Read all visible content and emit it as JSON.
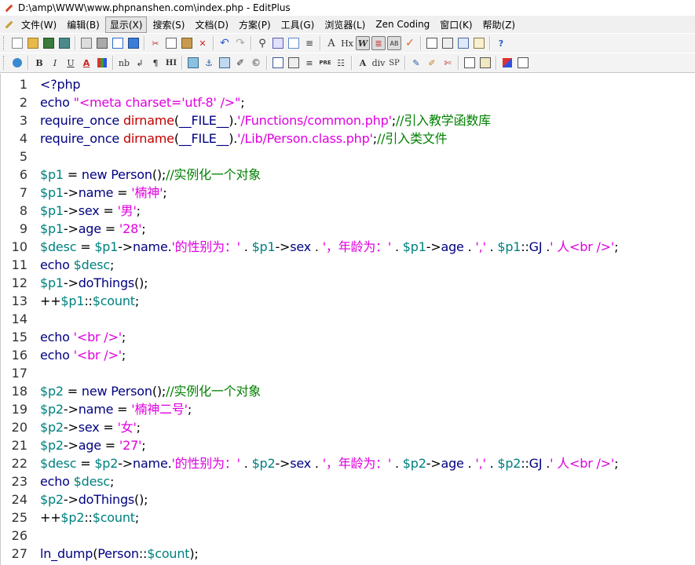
{
  "window": {
    "title": "D:\\amp\\WWW\\www.phpnanshen.com\\index.php - EditPlus"
  },
  "menu": [
    "文件(W)",
    "编辑(B)",
    "显示(X)",
    "搜索(S)",
    "文档(D)",
    "方案(P)",
    "工具(G)",
    "浏览器(L)",
    "Zen Coding",
    "窗口(K)",
    "帮助(Z)"
  ],
  "toolbar2_labels": {
    "hx": "Hx",
    "nb": "nb",
    "pilcrow": "¶",
    "hi": "HI",
    "pre": "PRE",
    "div": "div",
    "sp": "SP",
    "bold": "B",
    "italic": "I",
    "underline": "U",
    "fontcolor": "A"
  },
  "colors": {
    "keyword": "#000080",
    "string": "#e000e0",
    "function": "#c00000",
    "variable": "#008080",
    "comment": "#008000"
  },
  "code_lines": [
    [
      [
        "kw",
        "<?php"
      ]
    ],
    [
      [
        "kw",
        "echo "
      ],
      [
        "str",
        "\"<meta charset='utf-8' />\""
      ],
      [
        "op",
        ";"
      ]
    ],
    [
      [
        "kw",
        "require_once "
      ],
      [
        "fn",
        "dirname"
      ],
      [
        "op",
        "("
      ],
      [
        "kw",
        "__FILE__"
      ],
      [
        "op",
        ")."
      ],
      [
        "str",
        "'/Functions/common.php'"
      ],
      [
        "op",
        ";"
      ],
      [
        "cm",
        "//引入教学函数库"
      ]
    ],
    [
      [
        "kw",
        "require_once "
      ],
      [
        "fn",
        "dirname"
      ],
      [
        "op",
        "("
      ],
      [
        "kw",
        "__FILE__"
      ],
      [
        "op",
        ")."
      ],
      [
        "str",
        "'/Lib/Person.class.php'"
      ],
      [
        "op",
        ";"
      ],
      [
        "cm",
        "//引入类文件"
      ]
    ],
    [],
    [
      [
        "var",
        "$p1"
      ],
      [
        "op",
        " = "
      ],
      [
        "kw",
        "new Person"
      ],
      [
        "op",
        "();"
      ],
      [
        "cm",
        "//实例化一个对象"
      ]
    ],
    [
      [
        "var",
        "$p1"
      ],
      [
        "op",
        "->"
      ],
      [
        "kw",
        "name"
      ],
      [
        "op",
        " = "
      ],
      [
        "str",
        "'楠神'"
      ],
      [
        "op",
        ";"
      ]
    ],
    [
      [
        "var",
        "$p1"
      ],
      [
        "op",
        "->"
      ],
      [
        "kw",
        "sex"
      ],
      [
        "op",
        " = "
      ],
      [
        "str",
        "'男'"
      ],
      [
        "op",
        ";"
      ]
    ],
    [
      [
        "var",
        "$p1"
      ],
      [
        "op",
        "->"
      ],
      [
        "kw",
        "age"
      ],
      [
        "op",
        " = "
      ],
      [
        "str",
        "'28'"
      ],
      [
        "op",
        ";"
      ]
    ],
    [
      [
        "var",
        "$desc"
      ],
      [
        "op",
        " = "
      ],
      [
        "var",
        "$p1"
      ],
      [
        "op",
        "->"
      ],
      [
        "kw",
        "name"
      ],
      [
        "op",
        "."
      ],
      [
        "str",
        "'的性别为：'"
      ],
      [
        "op",
        " . "
      ],
      [
        "var",
        "$p1"
      ],
      [
        "op",
        "->"
      ],
      [
        "kw",
        "sex"
      ],
      [
        "op",
        " . "
      ],
      [
        "str",
        "'，年龄为：'"
      ],
      [
        "op",
        " . "
      ],
      [
        "var",
        "$p1"
      ],
      [
        "op",
        "->"
      ],
      [
        "kw",
        "age"
      ],
      [
        "op",
        " . "
      ],
      [
        "str",
        "','"
      ],
      [
        "op",
        " . "
      ],
      [
        "var",
        "$p1"
      ],
      [
        "op",
        "::"
      ],
      [
        "kw",
        "GJ"
      ],
      [
        "op",
        " ."
      ],
      [
        "str",
        "' 人<br />'"
      ],
      [
        "op",
        ";"
      ]
    ],
    [
      [
        "kw",
        "echo "
      ],
      [
        "var",
        "$desc"
      ],
      [
        "op",
        ";"
      ]
    ],
    [
      [
        "var",
        "$p1"
      ],
      [
        "op",
        "->"
      ],
      [
        "kw",
        "doThings"
      ],
      [
        "op",
        "();"
      ]
    ],
    [
      [
        "op",
        "++"
      ],
      [
        "var",
        "$p1"
      ],
      [
        "op",
        "::"
      ],
      [
        "var",
        "$count"
      ],
      [
        "op",
        ";"
      ]
    ],
    [],
    [
      [
        "kw",
        "echo "
      ],
      [
        "str",
        "'<br />'"
      ],
      [
        "op",
        ";"
      ]
    ],
    [
      [
        "kw",
        "echo "
      ],
      [
        "str",
        "'<br />'"
      ],
      [
        "op",
        ";"
      ]
    ],
    [],
    [
      [
        "var",
        "$p2"
      ],
      [
        "op",
        " = "
      ],
      [
        "kw",
        "new Person"
      ],
      [
        "op",
        "();"
      ],
      [
        "cm",
        "//实例化一个对象"
      ]
    ],
    [
      [
        "var",
        "$p2"
      ],
      [
        "op",
        "->"
      ],
      [
        "kw",
        "name"
      ],
      [
        "op",
        " = "
      ],
      [
        "str",
        "'楠神二号'"
      ],
      [
        "op",
        ";"
      ]
    ],
    [
      [
        "var",
        "$p2"
      ],
      [
        "op",
        "->"
      ],
      [
        "kw",
        "sex"
      ],
      [
        "op",
        " = "
      ],
      [
        "str",
        "'女'"
      ],
      [
        "op",
        ";"
      ]
    ],
    [
      [
        "var",
        "$p2"
      ],
      [
        "op",
        "->"
      ],
      [
        "kw",
        "age"
      ],
      [
        "op",
        " = "
      ],
      [
        "str",
        "'27'"
      ],
      [
        "op",
        ";"
      ]
    ],
    [
      [
        "var",
        "$desc"
      ],
      [
        "op",
        " = "
      ],
      [
        "var",
        "$p2"
      ],
      [
        "op",
        "->"
      ],
      [
        "kw",
        "name"
      ],
      [
        "op",
        "."
      ],
      [
        "str",
        "'的性别为：'"
      ],
      [
        "op",
        " . "
      ],
      [
        "var",
        "$p2"
      ],
      [
        "op",
        "->"
      ],
      [
        "kw",
        "sex"
      ],
      [
        "op",
        " . "
      ],
      [
        "str",
        "'，年龄为：'"
      ],
      [
        "op",
        " . "
      ],
      [
        "var",
        "$p2"
      ],
      [
        "op",
        "->"
      ],
      [
        "kw",
        "age"
      ],
      [
        "op",
        " . "
      ],
      [
        "str",
        "','"
      ],
      [
        "op",
        " . "
      ],
      [
        "var",
        "$p2"
      ],
      [
        "op",
        "::"
      ],
      [
        "kw",
        "GJ"
      ],
      [
        "op",
        " ."
      ],
      [
        "str",
        "' 人<br />'"
      ],
      [
        "op",
        ";"
      ]
    ],
    [
      [
        "kw",
        "echo "
      ],
      [
        "var",
        "$desc"
      ],
      [
        "op",
        ";"
      ]
    ],
    [
      [
        "var",
        "$p2"
      ],
      [
        "op",
        "->"
      ],
      [
        "kw",
        "doThings"
      ],
      [
        "op",
        "();"
      ]
    ],
    [
      [
        "op",
        "++"
      ],
      [
        "var",
        "$p2"
      ],
      [
        "op",
        "::"
      ],
      [
        "var",
        "$count"
      ],
      [
        "op",
        ";"
      ]
    ],
    [],
    [
      [
        "kw",
        "ln_dump"
      ],
      [
        "op",
        "("
      ],
      [
        "kw",
        "Person"
      ],
      [
        "op",
        "::"
      ],
      [
        "var",
        "$count"
      ],
      [
        "op",
        ");"
      ]
    ]
  ]
}
